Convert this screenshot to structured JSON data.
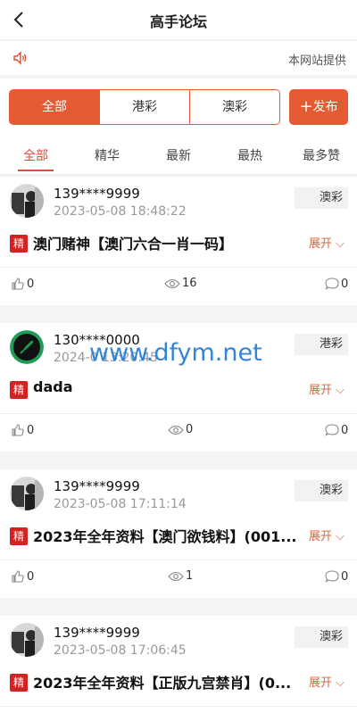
{
  "header": {
    "title": "高手论坛"
  },
  "notice": {
    "text": "本网站提供"
  },
  "segments": [
    "全部",
    "港彩",
    "澳彩"
  ],
  "publish_label": "发布",
  "filters": [
    "全部",
    "精华",
    "最新",
    "最热",
    "最多赞"
  ],
  "badge_label": "精",
  "expand_label": "展开",
  "posts": [
    {
      "user": "139****9999",
      "time": "2023-05-08 18:48:22",
      "tag": "澳彩",
      "title": "澳门赌神【澳门六合一肖一码】",
      "likes": "0",
      "views": "16",
      "comments": "0",
      "avatar": "car-driver-avatar"
    },
    {
      "user": "130****0000",
      "time": "2024-0 13:20:45",
      "tag": "港彩",
      "title": "dada",
      "likes": "0",
      "views": "0",
      "comments": "0",
      "avatar": "rocket-avatar"
    },
    {
      "user": "139****9999",
      "time": "2023-05-08 17:11:14",
      "tag": "澳彩",
      "title": "2023年全年资料【澳门欲钱料】(001...",
      "likes": "0",
      "views": "1",
      "comments": "0",
      "avatar": "car-driver-avatar"
    },
    {
      "user": "139****9999",
      "time": "2023-05-08 17:06:45",
      "tag": "澳彩",
      "title": "2023年全年资料【正版九宫禁肖】(0...",
      "likes": "",
      "views": "",
      "comments": "",
      "avatar": "car-driver-avatar"
    }
  ],
  "watermark": "www.dfym.net",
  "colors": {
    "accent": "#e45a33",
    "badge": "#d32222",
    "expand": "#d8643a",
    "watermark": "#2a7fd4"
  }
}
